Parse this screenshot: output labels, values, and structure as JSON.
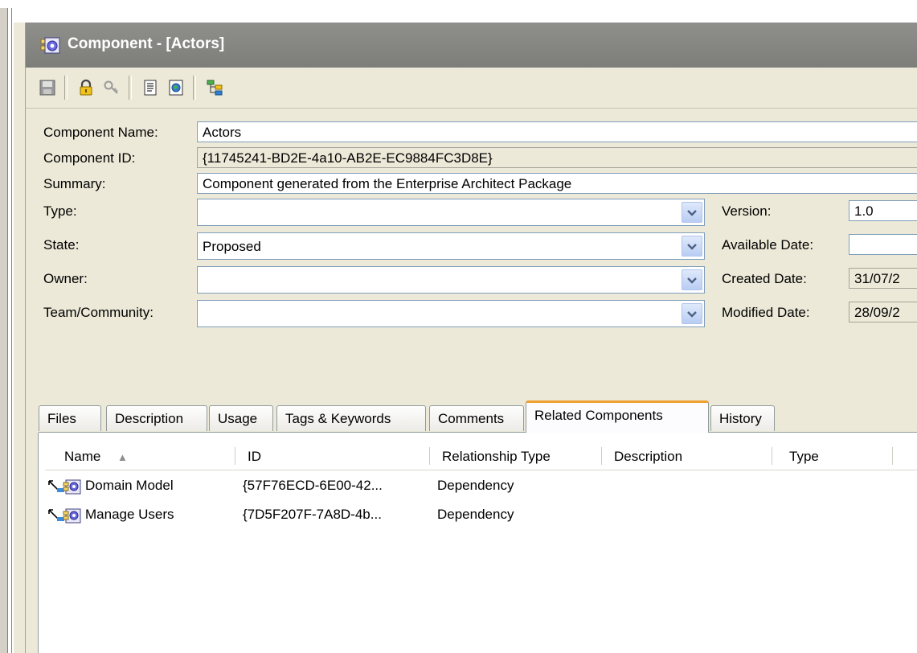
{
  "window": {
    "title": "Component - [Actors]"
  },
  "toolbar": {
    "buttons": [
      {
        "name": "save-icon"
      },
      {
        "name": "lock-icon"
      },
      {
        "name": "key-icon"
      },
      {
        "name": "document-icon"
      },
      {
        "name": "web-document-icon"
      },
      {
        "name": "hierarchy-icon"
      }
    ]
  },
  "form": {
    "component_name_label": "Component Name:",
    "component_name_value": "Actors",
    "component_id_label": "Component ID:",
    "component_id_value": "{11745241-BD2E-4a10-AB2E-EC9884FC3D8E}",
    "summary_label": "Summary:",
    "summary_value": "Component generated from the Enterprise Architect Package",
    "type_label": "Type:",
    "type_value": "",
    "state_label": "State:",
    "state_value": "Proposed",
    "owner_label": "Owner:",
    "owner_value": "",
    "team_label": "Team/Community:",
    "team_value": "",
    "version_label": "Version:",
    "version_value": "1.0",
    "available_date_label": "Available Date:",
    "available_date_value": "",
    "created_date_label": "Created Date:",
    "created_date_value": "31/07/2",
    "modified_date_label": "Modified Date:",
    "modified_date_value": "28/09/2"
  },
  "tabs": [
    {
      "label": "Files"
    },
    {
      "label": "Description"
    },
    {
      "label": "Usage"
    },
    {
      "label": "Tags & Keywords"
    },
    {
      "label": "Comments"
    },
    {
      "label": "Related Components",
      "active": true
    },
    {
      "label": "History"
    }
  ],
  "table": {
    "columns": [
      "Name",
      "ID",
      "Relationship Type",
      "Description",
      "Type"
    ],
    "sort_indicator": "▲",
    "rows": [
      {
        "name": "Domain Model",
        "id": "{57F76ECD-6E00-42...",
        "relationship": "Dependency",
        "description": "",
        "type": ""
      },
      {
        "name": "Manage Users",
        "id": "{7D5F207F-7A8D-4b...",
        "relationship": "Dependency",
        "description": "",
        "type": ""
      }
    ]
  },
  "colors": {
    "titlebar": "#7d7d7a",
    "panel": "#ece9d8",
    "active_tab_accent": "#f0a030",
    "field_border": "#7f9db9"
  }
}
